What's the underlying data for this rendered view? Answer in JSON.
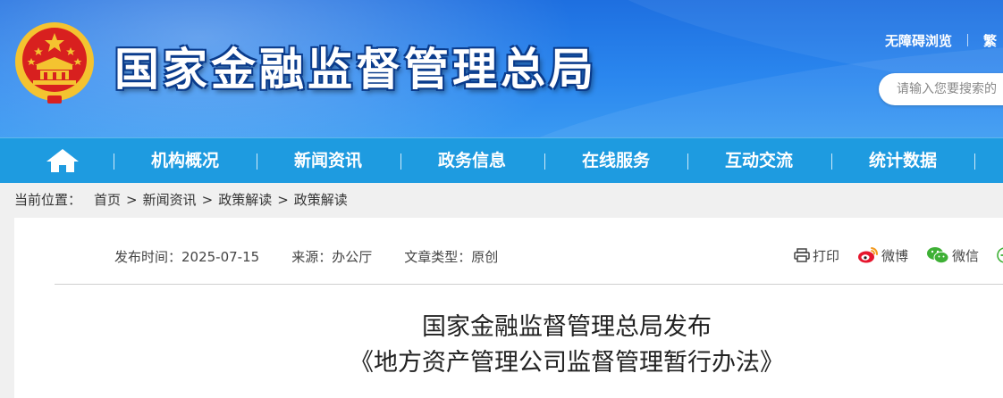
{
  "header": {
    "site_title": "国家金融监督管理总局",
    "links": [
      "无障碍浏览",
      "繁"
    ],
    "search": {
      "placeholder": "请输入您要搜索的"
    }
  },
  "nav": {
    "home_icon": "home-icon",
    "items": [
      "机构概况",
      "新闻资讯",
      "政务信息",
      "在线服务",
      "互动交流",
      "统计数据"
    ]
  },
  "breadcrumb": {
    "label": "当前位置：",
    "items": [
      "首页",
      "新闻资讯",
      "政策解读",
      "政策解读"
    ],
    "separator": ">"
  },
  "article": {
    "publish_time": "发布时间：2025-07-15",
    "source": "来源：办公厅",
    "type": "文章类型：原创",
    "share": {
      "print": "打印",
      "weibo": "微博",
      "wechat": "微信"
    },
    "title_line1": "国家金融监督管理总局发布",
    "title_line2": "《地方资产管理公司监督管理暂行办法》"
  },
  "colors": {
    "header_blue": "#2a86ee",
    "nav_blue": "#1e9be0",
    "emblem_red": "#d8201f",
    "emblem_gold": "#f4c330"
  }
}
